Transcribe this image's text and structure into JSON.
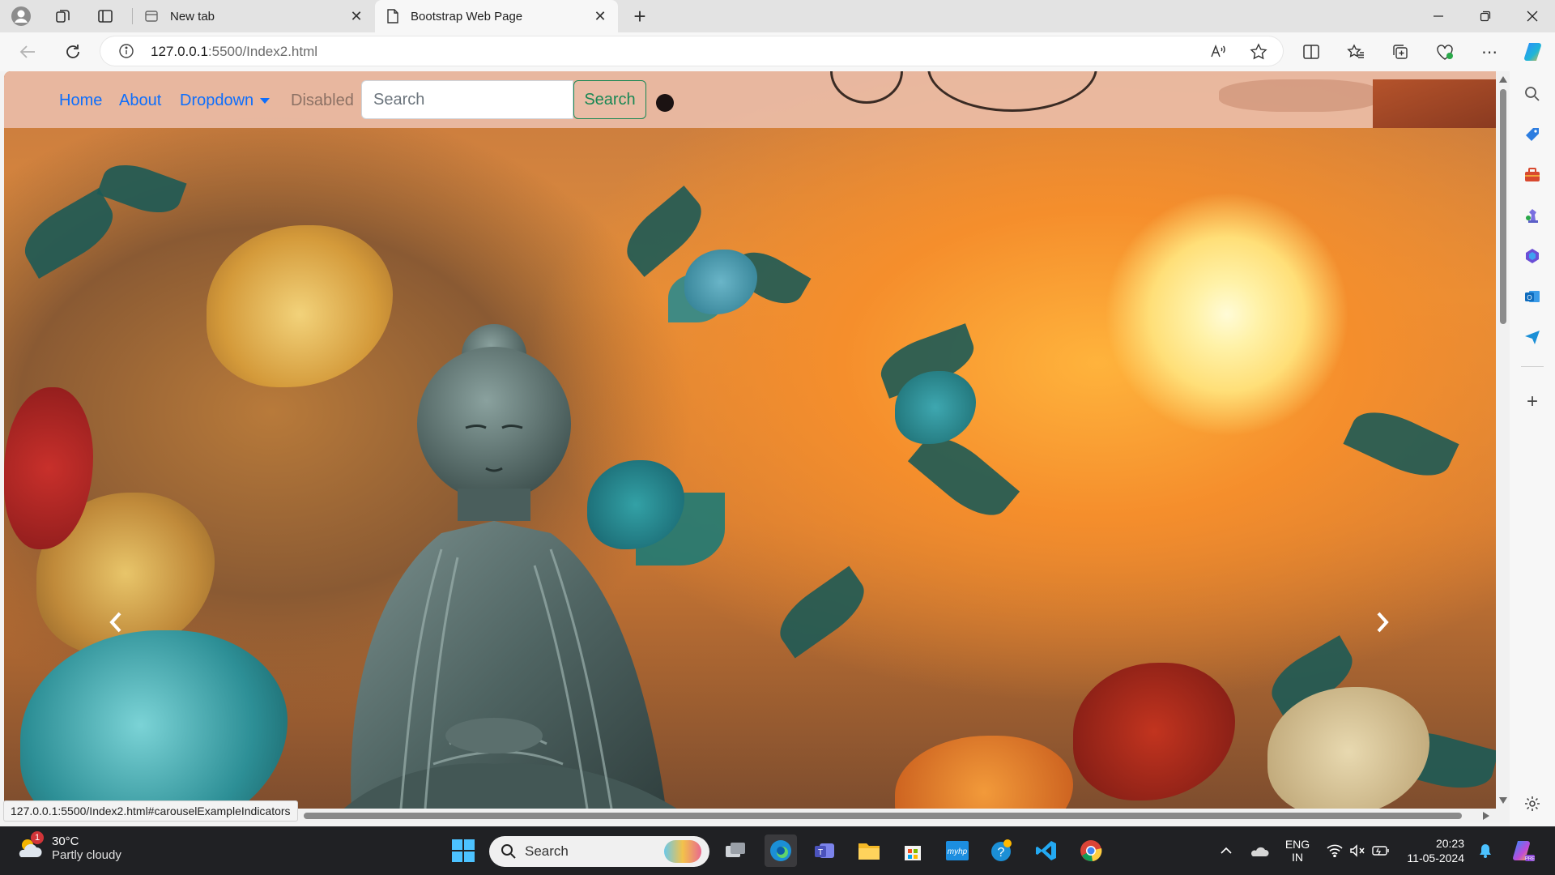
{
  "browser": {
    "tabs": [
      {
        "title": "New tab",
        "active": false
      },
      {
        "title": "Bootstrap Web Page",
        "active": true
      }
    ],
    "address_bar": {
      "host": "127.0.0.1",
      "rest": ":5500/Index2.html"
    }
  },
  "page": {
    "navbar": {
      "links": [
        "Home",
        "About",
        "Dropdown",
        "Disabled"
      ],
      "search_placeholder": "Search",
      "search_button": "Search"
    },
    "status_url": "127.0.0.1:5500/Index2.html#carouselExampleIndicators"
  },
  "taskbar": {
    "weather": {
      "temp": "30°C",
      "condition": "Partly cloudy",
      "badge": "1"
    },
    "search_label": "Search",
    "tray": {
      "lang_top": "ENG",
      "lang_bottom": "IN",
      "time": "20:23",
      "date": "11-05-2024"
    }
  },
  "colors": {
    "link": "#0d6efd",
    "success": "#198754",
    "taskbar": "#202124"
  }
}
